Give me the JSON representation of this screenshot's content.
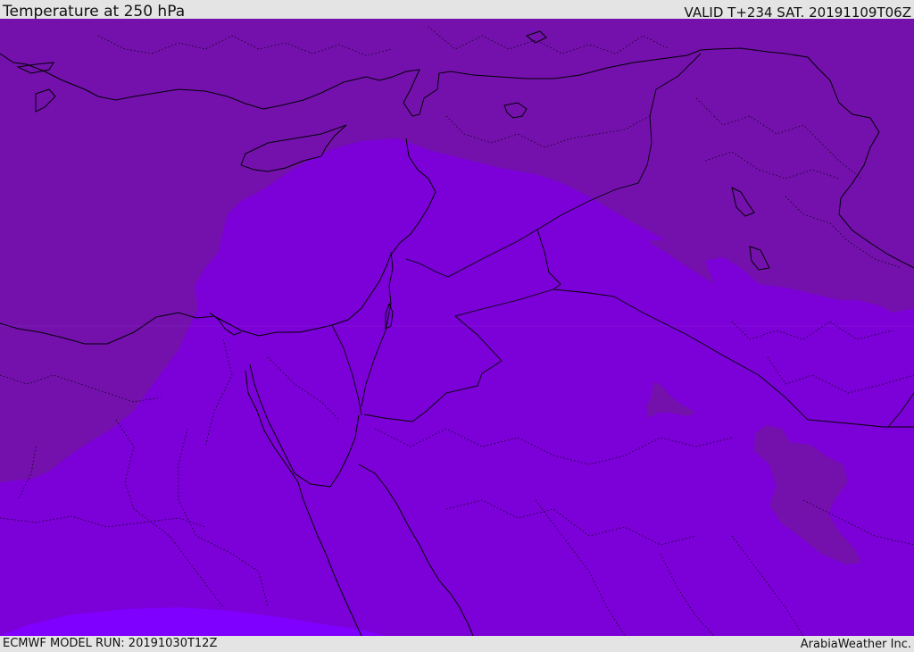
{
  "header": {
    "title": "Temperature at 250 hPa",
    "valid": "VALID T+234 SAT. 20191109T06Z"
  },
  "footer": {
    "model_run": "ECMWF MODEL RUN: 20191030T12Z",
    "credit": "ArabiaWeather Inc."
  },
  "map": {
    "colors": {
      "cold": "#7411ad",
      "mid": "#7c00d8",
      "warm": "#7f00ff",
      "coast": "#000000"
    }
  }
}
